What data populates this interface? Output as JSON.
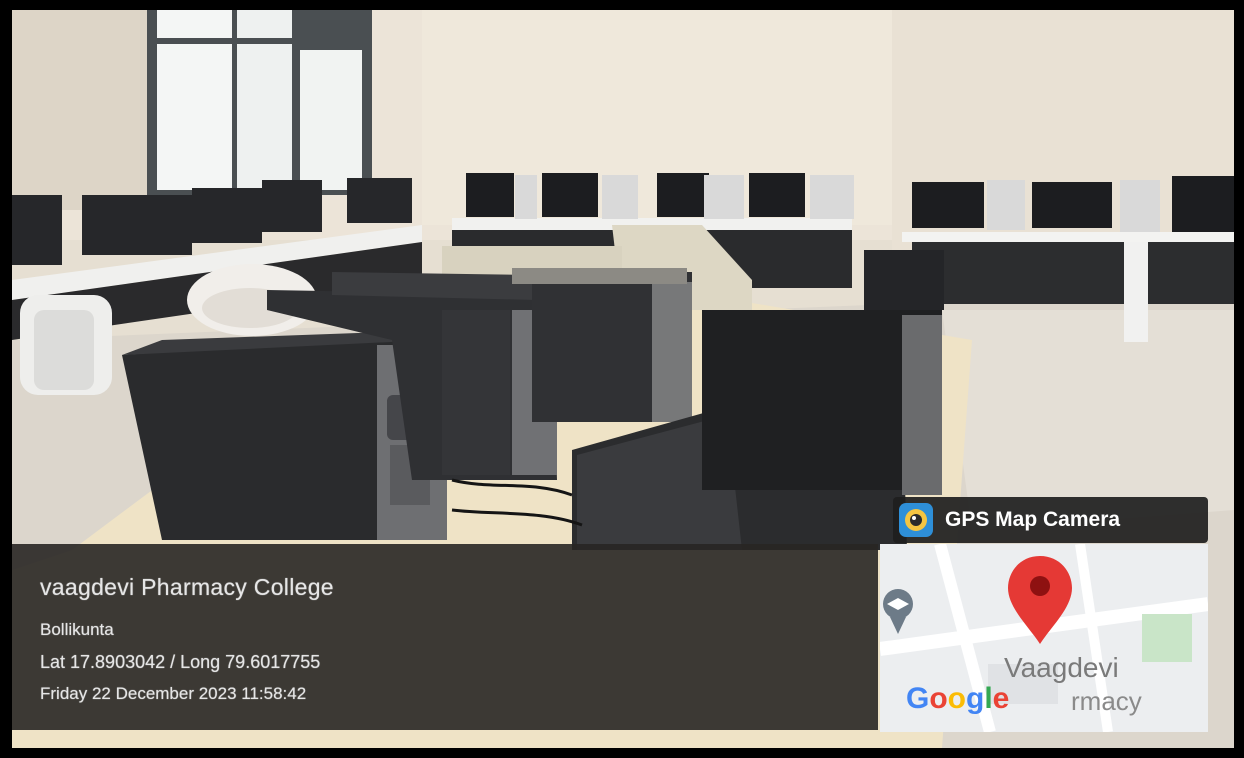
{
  "photo": {
    "subject": "computer-lab-photo"
  },
  "overlay": {
    "place_name": "vaagdevi Pharmacy College",
    "locality": "Bollikunta",
    "coordinates": "Lat 17.8903042 / Long 79.6017755",
    "datetime": "Friday 22 December 2023 11:58:42"
  },
  "badge": {
    "icon": "gps-camera-app-icon",
    "label": "GPS Map Camera"
  },
  "map": {
    "place_label": "Vaagdevi",
    "logo_letters": [
      "G",
      "o",
      "o",
      "g",
      "l",
      "e"
    ],
    "logo_colors": [
      "#4285F4",
      "#EA4335",
      "#FBBC05",
      "#4285F4",
      "#34A853",
      "#EA4335"
    ],
    "label_suffix": "rmacy",
    "pin_color": "#E53935",
    "pin_icon": "location-pin-icon"
  }
}
